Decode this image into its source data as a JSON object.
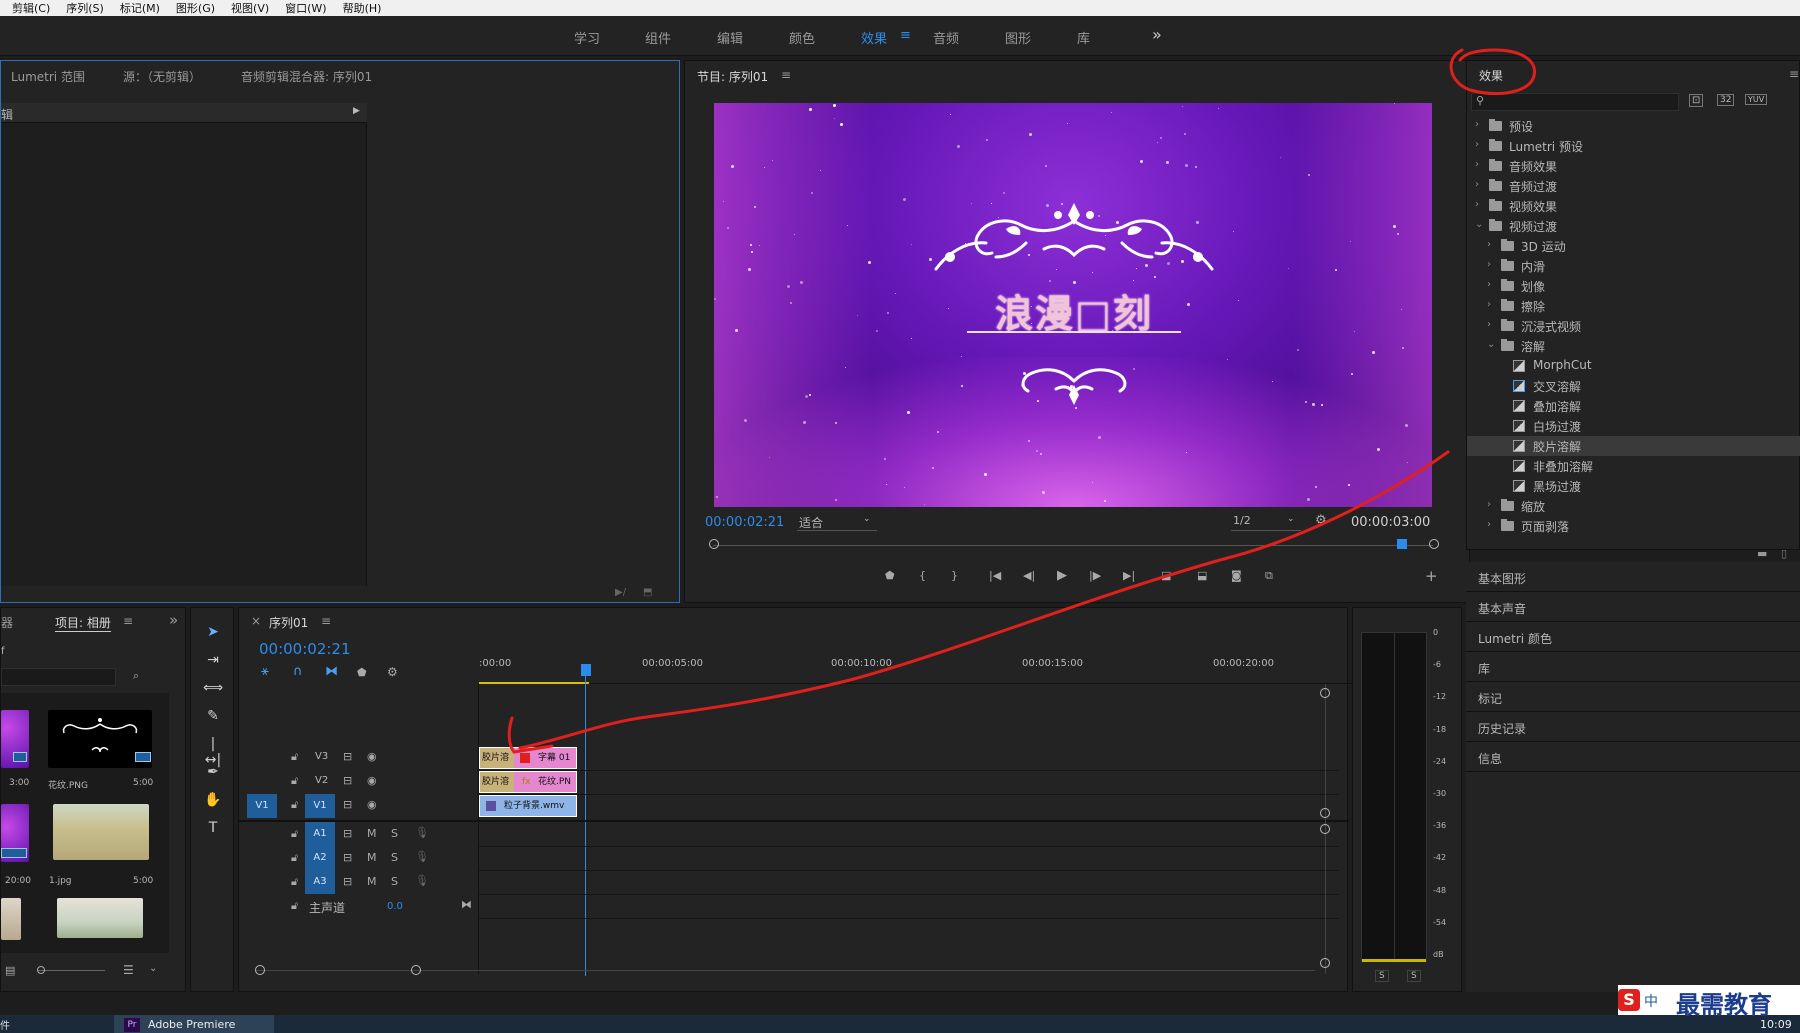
{
  "menu": [
    "剪辑(C)",
    "序列(S)",
    "标记(M)",
    "图形(G)",
    "视图(V)",
    "窗口(W)",
    "帮助(H)"
  ],
  "workspaces": [
    {
      "label": "学习",
      "active": false
    },
    {
      "label": "组件",
      "active": false
    },
    {
      "label": "编辑",
      "active": false
    },
    {
      "label": "颜色",
      "active": false
    },
    {
      "label": "效果",
      "active": true
    },
    {
      "label": "音频",
      "active": false
    },
    {
      "label": "图形",
      "active": false
    },
    {
      "label": "库",
      "active": false
    }
  ],
  "ws_menu_icon": "≡",
  "ws_overflow": "»",
  "source_panel": {
    "tabs": [
      "Lumetri 范围",
      "源：（无剪辑）",
      "音频剪辑混合器: 序列01"
    ],
    "list_label": "辑"
  },
  "program": {
    "title": "节目: 序列01",
    "menu": "≡",
    "timecode": "00:00:02:21",
    "fit": "适合",
    "quality": "1/2",
    "duration": "00:00:03:00",
    "video_title": "浪漫□刻"
  },
  "effects": {
    "title": "效果",
    "menu": "≡",
    "search_placeholder": "",
    "icons": [
      "accelerated-icon",
      "32bit-icon",
      "yuv-icon"
    ],
    "icon_labels": [
      "⊡",
      "32",
      "YUV"
    ],
    "tree": [
      {
        "label": "预设",
        "depth": 0,
        "kind": "folder-star",
        "open": false
      },
      {
        "label": "Lumetri 预设",
        "depth": 0,
        "kind": "folder-star",
        "open": false
      },
      {
        "label": "音频效果",
        "depth": 0,
        "kind": "folder",
        "open": false
      },
      {
        "label": "音频过渡",
        "depth": 0,
        "kind": "folder",
        "open": false
      },
      {
        "label": "视频效果",
        "depth": 0,
        "kind": "folder",
        "open": false
      },
      {
        "label": "视频过渡",
        "depth": 0,
        "kind": "folder",
        "open": true
      },
      {
        "label": "3D 运动",
        "depth": 1,
        "kind": "folder",
        "open": false
      },
      {
        "label": "内滑",
        "depth": 1,
        "kind": "folder",
        "open": false
      },
      {
        "label": "划像",
        "depth": 1,
        "kind": "folder",
        "open": false
      },
      {
        "label": "擦除",
        "depth": 1,
        "kind": "folder",
        "open": false
      },
      {
        "label": "沉浸式视频",
        "depth": 1,
        "kind": "folder",
        "open": false
      },
      {
        "label": "溶解",
        "depth": 1,
        "kind": "folder",
        "open": true
      },
      {
        "label": "MorphCut",
        "depth": 2,
        "kind": "fx",
        "open": false
      },
      {
        "label": "交叉溶解",
        "depth": 2,
        "kind": "fx-blue",
        "open": false
      },
      {
        "label": "叠加溶解",
        "depth": 2,
        "kind": "fx",
        "open": false
      },
      {
        "label": "白场过渡",
        "depth": 2,
        "kind": "fx",
        "open": false
      },
      {
        "label": "胶片溶解",
        "depth": 2,
        "kind": "fx",
        "open": false,
        "selected": true
      },
      {
        "label": "非叠加溶解",
        "depth": 2,
        "kind": "fx",
        "open": false
      },
      {
        "label": "黑场过渡",
        "depth": 2,
        "kind": "fx",
        "open": false
      },
      {
        "label": "缩放",
        "depth": 1,
        "kind": "folder",
        "open": false
      },
      {
        "label": "页面剥落",
        "depth": 1,
        "kind": "folder",
        "open": false
      }
    ],
    "sections": [
      "基本图形",
      "基本声音",
      "Lumetri 颜色",
      "库",
      "标记",
      "历史记录",
      "信息"
    ]
  },
  "project": {
    "tab_left": "器",
    "tab": "项目: 相册",
    "menu": "≡",
    "overflow": "»",
    "sub_label": "f",
    "items": [
      {
        "name": "",
        "duration": "3:00"
      },
      {
        "name": "花纹.PNG",
        "duration": "5:00"
      },
      {
        "name": "",
        "duration": "20:00"
      },
      {
        "name": "1.jpg",
        "duration": "5:00"
      }
    ]
  },
  "timeline": {
    "close": "×",
    "title": "序列01",
    "menu": "≡",
    "timecode": "00:00:02:21",
    "ruler": [
      ":00:00",
      "00:00:05:00",
      "00:00:10:00",
      "00:00:15:00",
      "00:00:20:00"
    ],
    "video_tracks": [
      "V3",
      "V2",
      "V1"
    ],
    "audio_tracks": [
      "A1",
      "A2",
      "A3"
    ],
    "source_patch": "V1",
    "mute": "M",
    "solo": "S",
    "master_label": "主声道",
    "master_value": "0.0",
    "clips": [
      {
        "track": "V3",
        "transition": "胶片溶",
        "label": "字幕 01"
      },
      {
        "track": "V2",
        "transition": "胶片溶",
        "fx": "fx",
        "label": "花纹.PN"
      },
      {
        "track": "V1",
        "label": "粒子背景.wmv"
      }
    ]
  },
  "meter": {
    "scale": [
      "0",
      "-6",
      "-12",
      "-18",
      "-24",
      "-30",
      "-36",
      "-42",
      "-48",
      "-54",
      "dB"
    ],
    "solo": [
      "S",
      "S"
    ]
  },
  "taskbar": {
    "app": "Adobe Premiere",
    "left": "件",
    "time": "10:09",
    "watermark": "最需教育",
    "ime": "中"
  },
  "colors": {
    "accent": "#2d8ceb",
    "annotation": "#e0201c",
    "clip_pink": "#e487cf",
    "clip_blue": "#8fb4e8",
    "transition": "#c9b27a"
  }
}
